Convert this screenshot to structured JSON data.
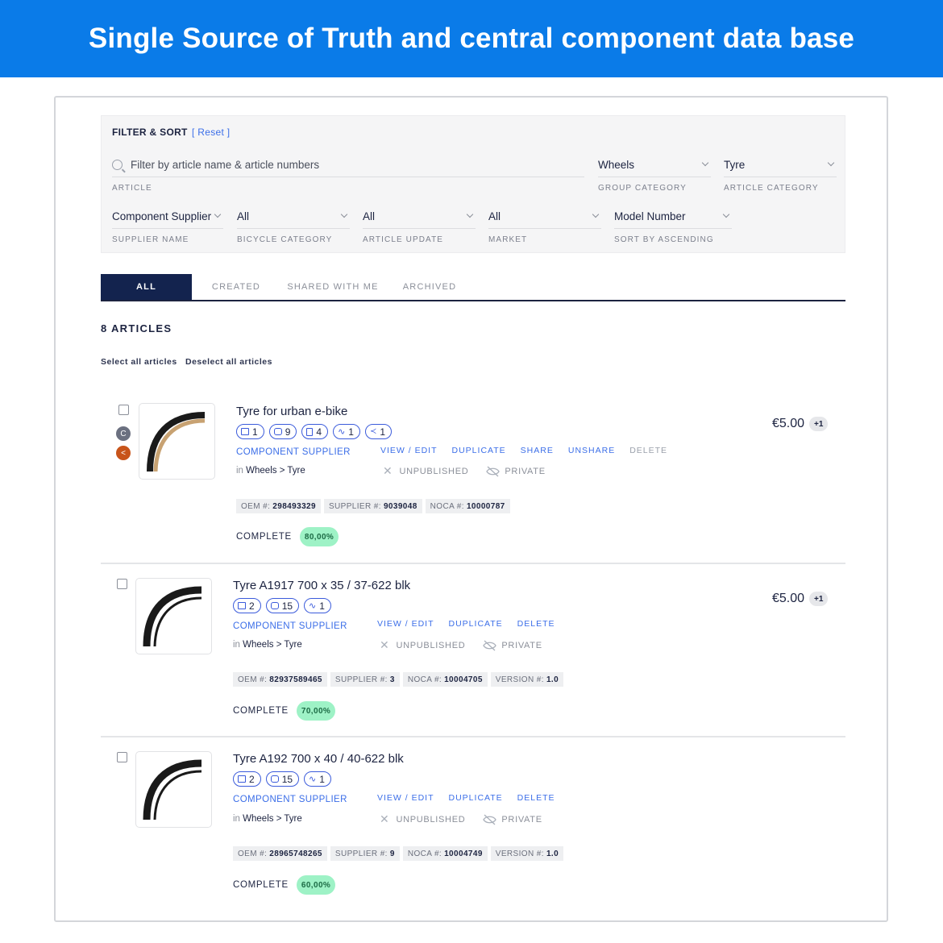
{
  "banner": {
    "title": "Single Source of Truth and central component data base"
  },
  "filter": {
    "title": "FILTER & SORT",
    "reset": "[ Reset ]",
    "search": {
      "placeholder": "Filter by article name & article numbers",
      "caption": "ARTICLE"
    },
    "group_category": {
      "value": "Wheels",
      "caption": "GROUP CATEGORY"
    },
    "article_category": {
      "value": "Tyre",
      "caption": "ARTICLE CATEGORY"
    },
    "supplier_name": {
      "value": "Component Supplier",
      "caption": "SUPPLIER NAME"
    },
    "bicycle_category": {
      "value": "All",
      "caption": "BICYCLE CATEGORY"
    },
    "article_update": {
      "value": "All",
      "caption": "ARTICLE UPDATE"
    },
    "market": {
      "value": "All",
      "caption": "MARKET"
    },
    "sort": {
      "value": "Model Number",
      "caption": "SORT BY ASCENDING"
    }
  },
  "tabs": [
    "ALL",
    "CREATED",
    "SHARED WITH ME",
    "ARCHIVED"
  ],
  "count_label": "8 ARTICLES",
  "select_all": "Select all articles",
  "deselect_all": "Deselect all articles",
  "articles": [
    {
      "title": "Tyre for urban e-bike",
      "avatars": [
        "C",
        "<"
      ],
      "pills": [
        {
          "icon": "image-icon",
          "value": "1"
        },
        {
          "icon": "layers-icon",
          "value": "9"
        },
        {
          "icon": "document-icon",
          "value": "4"
        },
        {
          "icon": "activity-icon",
          "value": "1"
        },
        {
          "icon": "share-icon",
          "value": "1"
        }
      ],
      "supplier": "COMPONENT SUPPLIER",
      "crumb_in": "in",
      "crumb": "Wheels > Tyre",
      "actions": [
        "VIEW / EDIT",
        "DUPLICATE",
        "SHARE",
        "UNSHARE",
        "DELETE"
      ],
      "unpublished": "UNPUBLISHED",
      "private": "PRIVATE",
      "ids": [
        {
          "label": "OEM #:",
          "value": "298493329"
        },
        {
          "label": "SUPPLIER #:",
          "value": "9039048"
        },
        {
          "label": "NOCA #:",
          "value": "10000787"
        }
      ],
      "complete_label": "COMPLETE",
      "complete_pct": "80,00%",
      "price": "€5.00",
      "price_more": "+1"
    },
    {
      "title": "Tyre A1917  700 x 35 / 37-622 blk",
      "pills": [
        {
          "icon": "image-icon",
          "value": "2"
        },
        {
          "icon": "layers-icon",
          "value": "15"
        },
        {
          "icon": "activity-icon",
          "value": "1"
        }
      ],
      "supplier": "COMPONENT SUPPLIER",
      "crumb_in": "in",
      "crumb": "Wheels > Tyre",
      "actions": [
        "VIEW / EDIT",
        "DUPLICATE",
        "DELETE"
      ],
      "unpublished": "UNPUBLISHED",
      "private": "PRIVATE",
      "ids": [
        {
          "label": "OEM #:",
          "value": "82937589465"
        },
        {
          "label": "SUPPLIER #:",
          "value": "3"
        },
        {
          "label": "NOCA #:",
          "value": "10004705"
        },
        {
          "label": "VERSION #:",
          "value": "1.0"
        }
      ],
      "complete_label": "COMPLETE",
      "complete_pct": "70,00%",
      "price": "€5.00",
      "price_more": "+1"
    },
    {
      "title": "Tyre A192 700 x 40 / 40-622 blk",
      "pills": [
        {
          "icon": "image-icon",
          "value": "2"
        },
        {
          "icon": "layers-icon",
          "value": "15"
        },
        {
          "icon": "activity-icon",
          "value": "1"
        }
      ],
      "supplier": "COMPONENT SUPPLIER",
      "crumb_in": "in",
      "crumb": "Wheels > Tyre",
      "actions": [
        "VIEW / EDIT",
        "DUPLICATE",
        "DELETE"
      ],
      "unpublished": "UNPUBLISHED",
      "private": "PRIVATE",
      "ids": [
        {
          "label": "OEM #:",
          "value": "28965748265"
        },
        {
          "label": "SUPPLIER #:",
          "value": "9"
        },
        {
          "label": "NOCA #:",
          "value": "10004749"
        },
        {
          "label": "VERSION #:",
          "value": "1.0"
        }
      ],
      "complete_label": "COMPLETE",
      "complete_pct": "60,00%"
    }
  ],
  "colors": {
    "banner": "#0a7be8",
    "link": "#3b6ee8",
    "active_tab": "#13234e",
    "complete_badge": "#9ef2c6",
    "avatar_c": "#6b7080",
    "avatar_share": "#c8541a"
  }
}
